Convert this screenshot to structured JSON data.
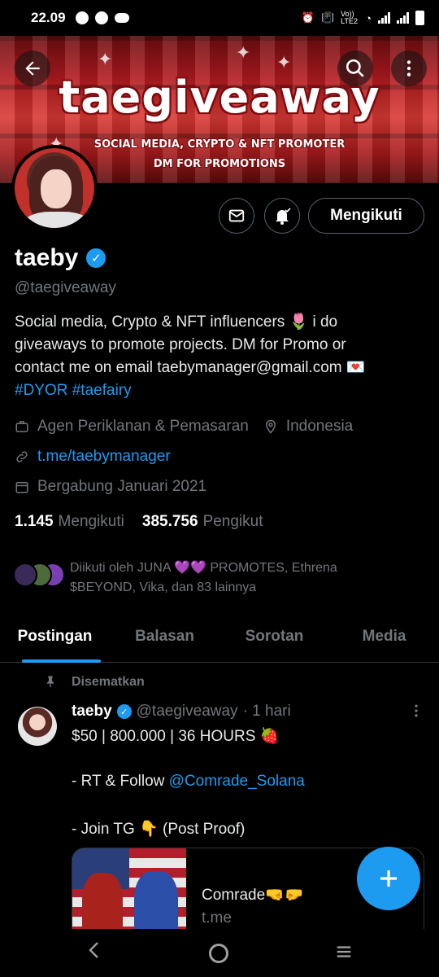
{
  "status_bar": {
    "time": "22.09",
    "network_label": "Vo)) LTE2"
  },
  "banner": {
    "title": "taegiveaway",
    "subtitle_1": "SOCIAL MEDIA, CRYPTO & NFT PROMOTER",
    "subtitle_2": "DM FOR PROMOTIONS"
  },
  "actions": {
    "follow_label": "Mengikuti"
  },
  "profile": {
    "name": "taeby",
    "handle": "@taegiveaway",
    "bio_lines": [
      "Social media, Crypto & NFT influencers 🌷 i do",
      "giveaways to promote projects. DM for Promo or",
      "contact me on email taebymanager@gmail.com 💌"
    ],
    "hashtags": "#DYOR #taefairy",
    "category": "Agen Periklanan & Pemasaran",
    "location": "Indonesia",
    "link": "t.me/taebymanager",
    "joined": "Bergabung Januari 2021",
    "following_count": "1.145",
    "following_label": "Mengikuti",
    "followers_count": "385.756",
    "followers_label": "Pengikut",
    "followed_by": "Diikuti oleh JUNA 💜💜 PROMOTES, Ethrena $BEYOND, Vika, dan 83 lainnya"
  },
  "tabs": [
    {
      "label": "Postingan",
      "active": true
    },
    {
      "label": "Balasan",
      "active": false
    },
    {
      "label": "Sorotan",
      "active": false
    },
    {
      "label": "Media",
      "active": false
    }
  ],
  "post": {
    "pinned_label": "Disematkan",
    "author_name": "taeby",
    "author_handle": "@taegiveaway",
    "time": "· 1 hari",
    "line1": "$50 | 800.000 | 36 HOURS 🍓",
    "line2_prefix": "- RT & Follow ",
    "line2_mention": "@Comrade_Solana",
    "line3": "- Join TG 👇 (Post Proof)",
    "card_title": "Comrade🤜🤛",
    "card_domain": "t.me"
  },
  "colors": {
    "accent": "#1d9bf0",
    "muted_text": "#71767b",
    "background": "#000000"
  }
}
